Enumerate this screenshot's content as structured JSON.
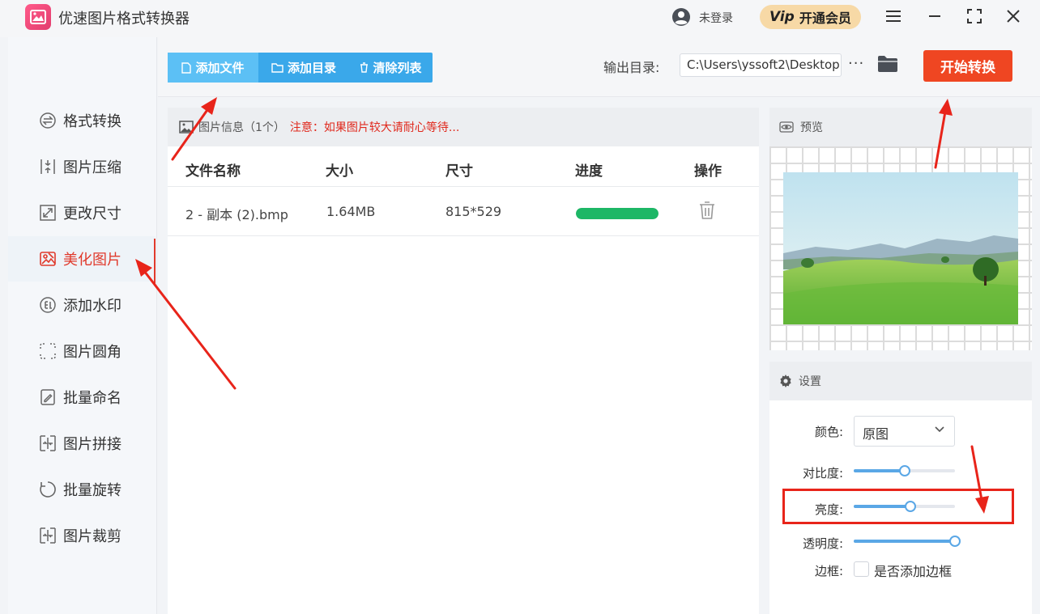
{
  "app": {
    "title": "优速图片格式转换器"
  },
  "titlebar": {
    "login": "未登录",
    "vip_badge": "Vip",
    "vip_label": "开通会员"
  },
  "sidebar": {
    "items": [
      {
        "label": "格式转换",
        "icon": "format-convert-icon"
      },
      {
        "label": "图片压缩",
        "icon": "compress-icon"
      },
      {
        "label": "更改尺寸",
        "icon": "resize-icon"
      },
      {
        "label": "美化图片",
        "icon": "beautify-icon",
        "active": true
      },
      {
        "label": "添加水印",
        "icon": "watermark-icon"
      },
      {
        "label": "图片圆角",
        "icon": "rounded-corner-icon"
      },
      {
        "label": "批量命名",
        "icon": "rename-icon"
      },
      {
        "label": "图片拼接",
        "icon": "stitch-icon"
      },
      {
        "label": "批量旋转",
        "icon": "rotate-icon"
      },
      {
        "label": "图片裁剪",
        "icon": "crop-icon"
      }
    ]
  },
  "toolbar": {
    "add_file": "添加文件",
    "add_folder": "添加目录",
    "clear_list": "清除列表",
    "output_label": "输出目录:",
    "output_path": "C:\\Users\\yssoft2\\Desktop",
    "more": "···",
    "start": "开始转换"
  },
  "files": {
    "header_title": "图片信息（1个）",
    "notice": "注意：如果图片较大请耐心等待...",
    "columns": {
      "name": "文件名称",
      "size": "大小",
      "dims": "尺寸",
      "progress": "进度",
      "action": "操作"
    },
    "rows": [
      {
        "name": "2 - 副本 (2).bmp",
        "size": "1.64MB",
        "dims": "815*529",
        "progress": 1.0
      }
    ]
  },
  "preview": {
    "title": "预览"
  },
  "settings": {
    "title": "设置",
    "color_label": "颜色:",
    "color_value": "原图",
    "contrast_label": "对比度:",
    "contrast": 0.5,
    "brightness_label": "亮度:",
    "brightness": 0.56,
    "opacity_label": "透明度:",
    "opacity": 1.0,
    "border_label": "边框:",
    "border_checkbox": "是否添加边框"
  },
  "colors": {
    "accent": "#3aa8ea",
    "start": "#ef4622",
    "active": "#e03a2c",
    "progress": "#1db766"
  }
}
